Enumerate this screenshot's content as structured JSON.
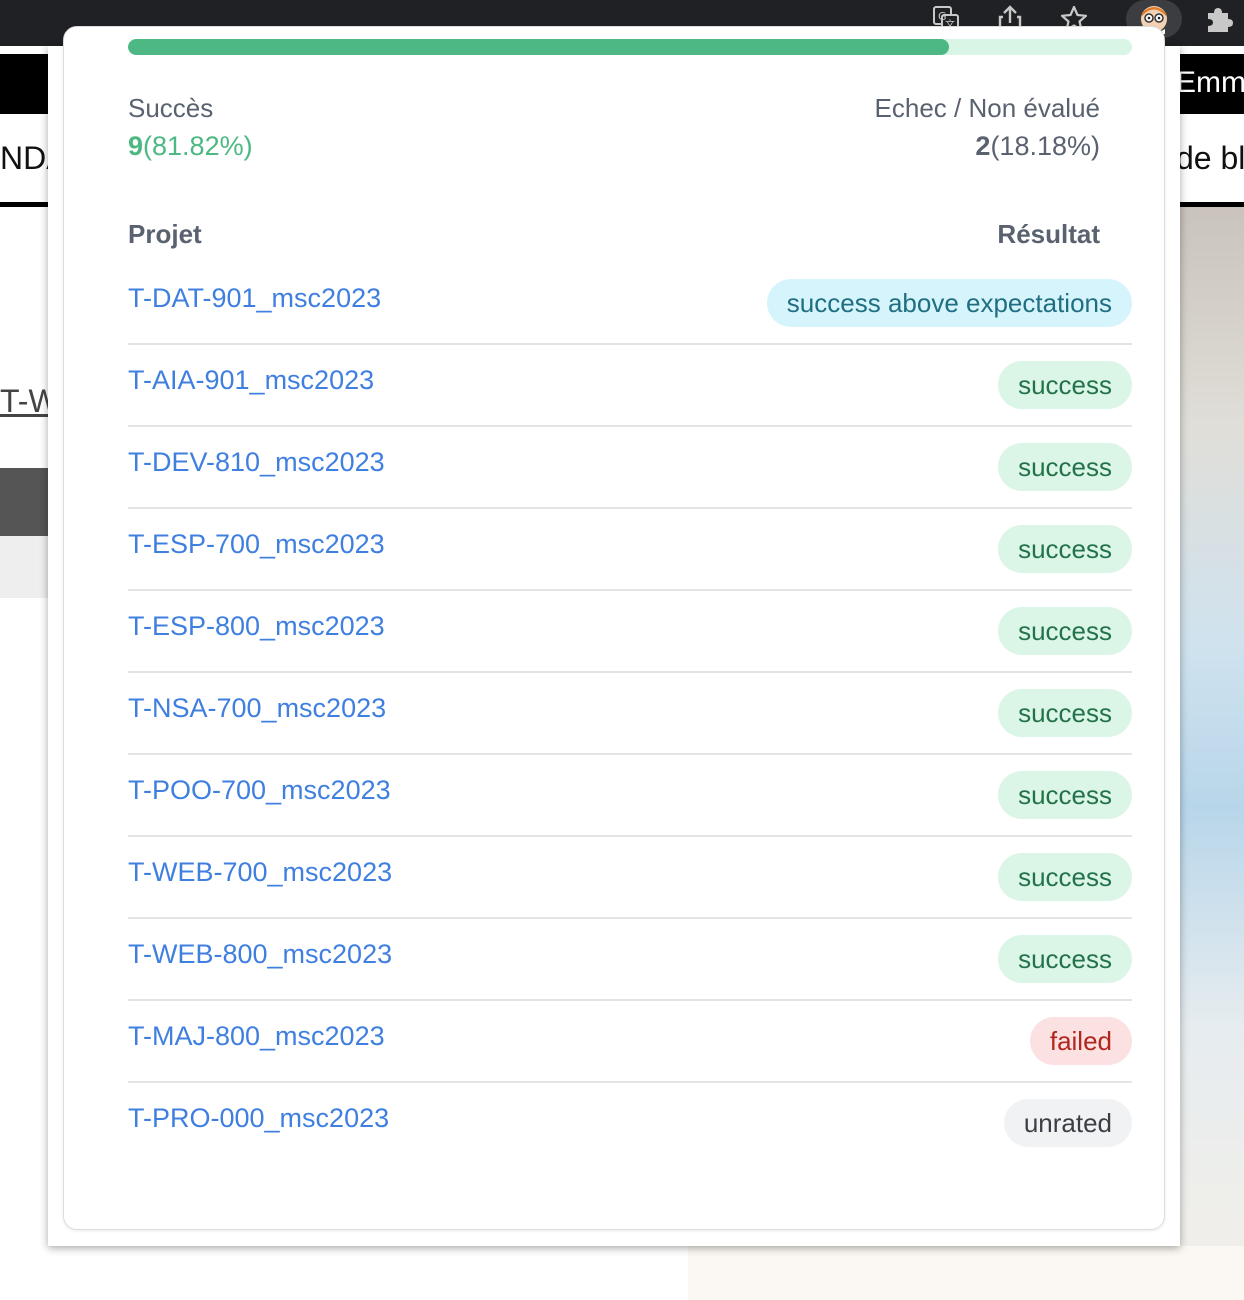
{
  "browser": {
    "icons": [
      "translate-icon",
      "share-icon",
      "bookmark-star-icon",
      "extension-avatar-icon",
      "extensions-puzzle-icon"
    ]
  },
  "background_page": {
    "nav_text_right": "Emm",
    "subnav_text_left": "NDA",
    "subnav_text_right": "de bl",
    "link_left": "T-W"
  },
  "summary": {
    "success_label": "Succès",
    "success_count": "9",
    "success_percent": "(81.82%)",
    "fail_label": "Echec / Non évalué",
    "fail_count": "2",
    "fail_percent": "(18.18%)",
    "progress_fraction": 0.8182,
    "colors": {
      "success": "#4db883",
      "track": "#d9f5e6"
    }
  },
  "table": {
    "col_project": "Projet",
    "col_result": "Résultat",
    "rows": [
      {
        "project": "T-DAT-901_msc2023",
        "result": "success above expectations",
        "status": "above"
      },
      {
        "project": "T-AIA-901_msc2023",
        "result": "success",
        "status": "success"
      },
      {
        "project": "T-DEV-810_msc2023",
        "result": "success",
        "status": "success"
      },
      {
        "project": "T-ESP-700_msc2023",
        "result": "success",
        "status": "success"
      },
      {
        "project": "T-ESP-800_msc2023",
        "result": "success",
        "status": "success"
      },
      {
        "project": "T-NSA-700_msc2023",
        "result": "success",
        "status": "success"
      },
      {
        "project": "T-POO-700_msc2023",
        "result": "success",
        "status": "success"
      },
      {
        "project": "T-WEB-700_msc2023",
        "result": "success",
        "status": "success"
      },
      {
        "project": "T-WEB-800_msc2023",
        "result": "success",
        "status": "success"
      },
      {
        "project": "T-MAJ-800_msc2023",
        "result": "failed",
        "status": "failed"
      },
      {
        "project": "T-PRO-000_msc2023",
        "result": "unrated",
        "status": "unrated"
      }
    ]
  },
  "badge_styles": {
    "above": {
      "bg": "#d6f4fb",
      "fg": "#1f6e82"
    },
    "success": {
      "bg": "#dbf5e6",
      "fg": "#23734a"
    },
    "failed": {
      "bg": "#fbe1e1",
      "fg": "#b3261e"
    },
    "unrated": {
      "bg": "#f1f2f4",
      "fg": "#3b3f45"
    }
  }
}
